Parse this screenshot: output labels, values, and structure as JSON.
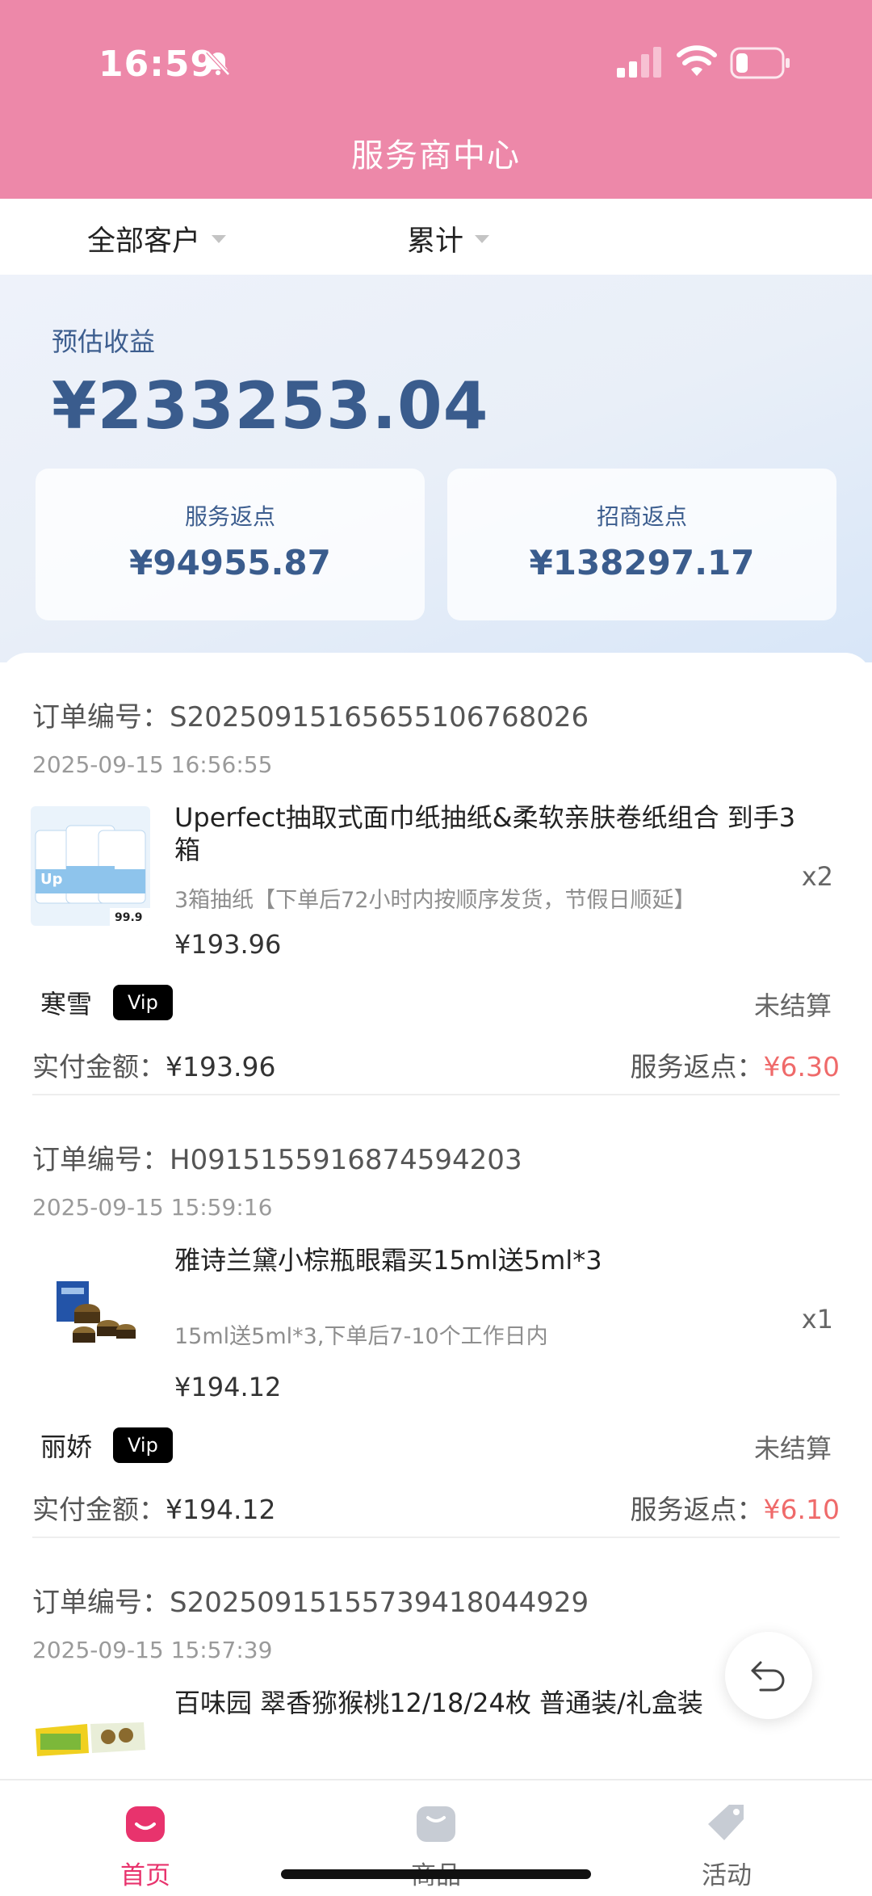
{
  "status_bar": {
    "time": "16:59"
  },
  "header": {
    "title": "服务商中心"
  },
  "filters": {
    "customer": "全部客户",
    "period": "累计"
  },
  "summary": {
    "estimated_label": "预估收益",
    "estimated_value": "¥233253.04",
    "service_label": "服务返点",
    "service_value": "¥94955.87",
    "merchant_label": "招商返点",
    "merchant_value": "¥138297.17"
  },
  "orders": [
    {
      "order_no": "订单编号：S2025091516565510676802​6",
      "time": "2025-09-15 16:56:55",
      "title": "Uperfect抽取式面巾纸抽纸&柔软亲肤卷纸组合 到手3箱",
      "spec": "3箱抽纸【下单后72小时内按顺序发货，节假日顺延】",
      "qty": "x2",
      "price": "¥193.96",
      "buyer": "寒雪",
      "vip": "Vip",
      "settle": "未结算",
      "paid_label": "实付金额：",
      "paid": "¥193.96",
      "rebate_label": "服务返点：",
      "rebate": "¥6.30",
      "thumb_price": "99.9"
    },
    {
      "order_no": "订单编号：H0915155916874594203",
      "time": "2025-09-15 15:59:16",
      "title": "雅诗兰黛小棕瓶眼霜买15ml送5ml*3",
      "spec": "15ml送5ml*3,下单后7-10个工作日内",
      "qty": "x1",
      "price": "¥194.12",
      "buyer": "丽娇",
      "vip": "Vip",
      "settle": "未结算",
      "paid_label": "实付金额：",
      "paid": "¥194.12",
      "rebate_label": "服务返点：",
      "rebate": "¥6.10"
    },
    {
      "order_no": "订单编号：S20250915155739418044929",
      "time": "2025-09-15 15:57:39",
      "title": "百味园 翠香猕猴桃12/18/24枚 普通装/礼盒装"
    }
  ],
  "tabs": [
    {
      "label": "首页",
      "active": true
    },
    {
      "label": "商品",
      "active": false
    },
    {
      "label": "活动",
      "active": false
    }
  ],
  "colors": {
    "header": "#ed88a9",
    "accent": "#e8336d",
    "rebate": "#ef6a6a",
    "summary_text": "#3a5c8d"
  }
}
